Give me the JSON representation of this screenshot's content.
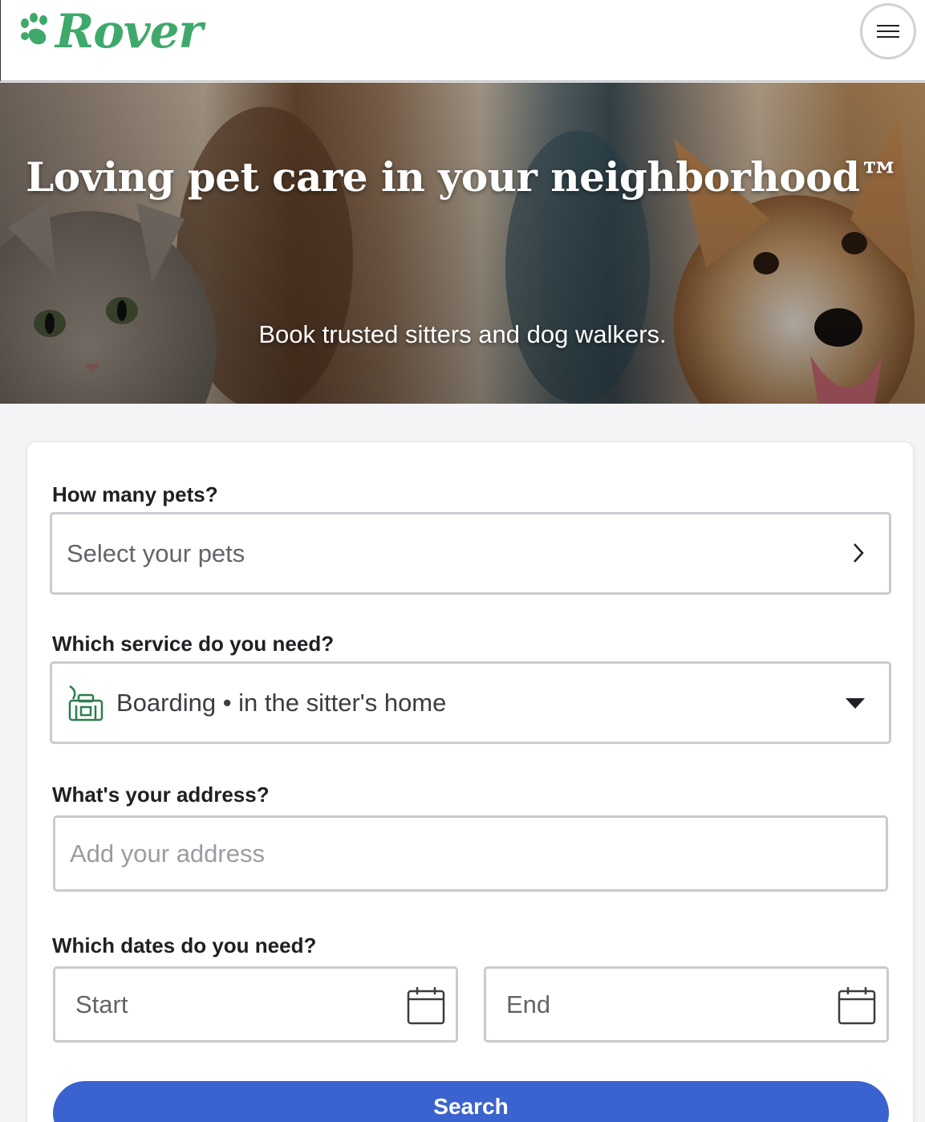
{
  "brand": {
    "name": "Rover",
    "color": "#3ea96a"
  },
  "header": {
    "menu_icon": "hamburger-menu-icon"
  },
  "hero": {
    "title": "Loving pet care in your neighborhood™",
    "subtitle": "Book trusted sitters and dog walkers."
  },
  "form": {
    "pets": {
      "label": "How many pets?",
      "placeholder": "Select your pets",
      "icon": "chevron-right-icon"
    },
    "service": {
      "label": "Which service do you need?",
      "value": "Boarding • in the sitter's home",
      "icon": "boarding-icon",
      "dropdown_icon": "caret-down-icon"
    },
    "address": {
      "label": "What's your address?",
      "placeholder": "Add your address"
    },
    "dates": {
      "label": "Which dates do you need?",
      "start_placeholder": "Start",
      "end_placeholder": "End",
      "icon": "calendar-icon"
    },
    "search_label": "Search"
  },
  "colors": {
    "button": "#3b63cf",
    "border": "#c9cbd0"
  }
}
